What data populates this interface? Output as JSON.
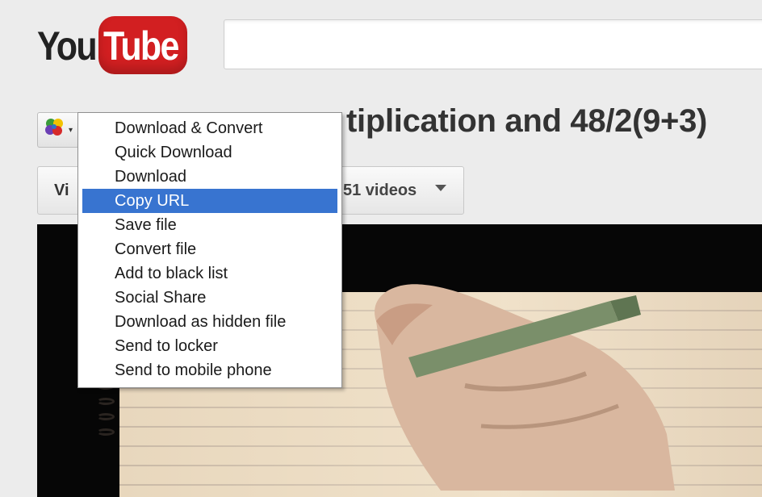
{
  "header": {
    "logo_you": "You",
    "logo_tube": "Tube",
    "search_value": ""
  },
  "video": {
    "title_partial": "tiplication and 48/2(9+3)",
    "toolbar_left_partial": "Vi",
    "toolbar_right_partial": "51 videos"
  },
  "context_menu": {
    "items": [
      {
        "label": "Download & Convert",
        "selected": false
      },
      {
        "label": "Quick Download",
        "selected": false
      },
      {
        "label": "Download",
        "selected": false
      },
      {
        "label": "Copy URL",
        "selected": true
      },
      {
        "label": "Save file",
        "selected": false
      },
      {
        "label": "Convert file",
        "selected": false
      },
      {
        "label": "Add to black list",
        "selected": false
      },
      {
        "label": "Social Share",
        "selected": false
      },
      {
        "label": "Download as hidden file",
        "selected": false
      },
      {
        "label": "Send to locker",
        "selected": false
      },
      {
        "label": "Send to mobile phone",
        "selected": false
      }
    ]
  },
  "colors": {
    "youtube_red": "#d21f21",
    "menu_highlight": "#3874d0",
    "player_background": "#060606"
  },
  "icons": {
    "extension": "colored-circles-icon",
    "dropdown": "chevron-down-icon"
  }
}
